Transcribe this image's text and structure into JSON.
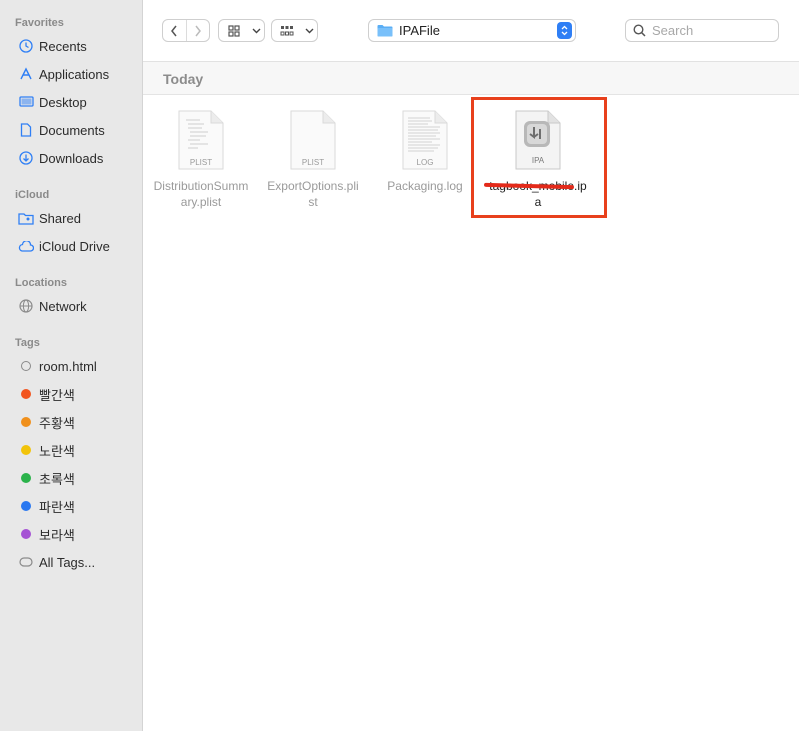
{
  "sidebar": {
    "favorites": {
      "header": "Favorites",
      "items": [
        {
          "label": "Recents",
          "icon": "clock-icon"
        },
        {
          "label": "Applications",
          "icon": "applications-icon"
        },
        {
          "label": "Desktop",
          "icon": "desktop-icon"
        },
        {
          "label": "Documents",
          "icon": "document-icon"
        },
        {
          "label": "Downloads",
          "icon": "download-icon"
        }
      ]
    },
    "icloud": {
      "header": "iCloud",
      "items": [
        {
          "label": "Shared",
          "icon": "shared-folder-icon"
        },
        {
          "label": "iCloud Drive",
          "icon": "cloud-icon"
        }
      ]
    },
    "locations": {
      "header": "Locations",
      "items": [
        {
          "label": "Network",
          "icon": "globe-icon"
        }
      ]
    },
    "tags": {
      "header": "Tags",
      "items": [
        {
          "label": "room.html",
          "color": "none"
        },
        {
          "label": "빨간색",
          "color": "#f2541e"
        },
        {
          "label": "주황색",
          "color": "#f0901c"
        },
        {
          "label": "노란색",
          "color": "#f2c40a"
        },
        {
          "label": "초록색",
          "color": "#2ab24a"
        },
        {
          "label": "파란색",
          "color": "#2a78f0"
        },
        {
          "label": "보라색",
          "color": "#a552d4"
        },
        {
          "label": "All Tags...",
          "color": "all"
        }
      ]
    }
  },
  "toolbar": {
    "path_label": "IPAFile",
    "search_placeholder": "Search"
  },
  "group": {
    "title": "Today"
  },
  "files": [
    {
      "name_line1": "DistributionSumm",
      "name_line2": "ary.plist",
      "badge": "PLIST",
      "selected": false
    },
    {
      "name_line1": "ExportOptions.pli",
      "name_line2": "st",
      "badge": "PLIST",
      "selected": false
    },
    {
      "name_line1": "Packaging.log",
      "name_line2": "",
      "badge": "LOG",
      "selected": false
    },
    {
      "name_line1": "tagbook_mobile.ip",
      "name_line2": "a",
      "badge": "IPA",
      "selected": true
    }
  ],
  "colors": {
    "highlight": "#e8401c",
    "accent": "#2f7ff5"
  }
}
